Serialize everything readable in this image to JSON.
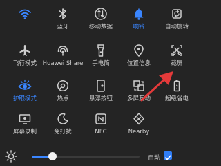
{
  "colors": {
    "background": "#242424",
    "text": "#cfcfcf",
    "active": "#3a86ff",
    "arrow": "#e43a3a"
  },
  "tiles": [
    {
      "label": "",
      "icon": "wifi-icon",
      "active": true
    },
    {
      "label": "蓝牙",
      "icon": "bluetooth-icon",
      "active": false
    },
    {
      "label": "移动数据",
      "icon": "mobile-data-icon",
      "active": false
    },
    {
      "label": "响铃",
      "icon": "bell-icon",
      "active": true
    },
    {
      "label": "自动旋转",
      "icon": "rotate-icon",
      "active": false
    },
    {
      "label": "飞行模式",
      "icon": "airplane-icon",
      "active": false
    },
    {
      "label": "Huawei Share",
      "icon": "huawei-share-icon",
      "active": false
    },
    {
      "label": "手电筒",
      "icon": "flashlight-icon",
      "active": false
    },
    {
      "label": "位置信息",
      "icon": "location-icon",
      "active": false
    },
    {
      "label": "截屏",
      "icon": "screenshot-icon",
      "active": false
    },
    {
      "label": "护眼模式",
      "icon": "eye-comfort-icon",
      "active": true
    },
    {
      "label": "热点",
      "icon": "hotspot-icon",
      "active": false
    },
    {
      "label": "悬浮按钮",
      "icon": "floating-button-icon",
      "active": false
    },
    {
      "label": "多屏互动",
      "icon": "multi-screen-icon",
      "active": false
    },
    {
      "label": "超级省电",
      "icon": "battery-saver-icon",
      "active": false
    },
    {
      "label": "屏幕录制",
      "icon": "screen-record-icon",
      "active": false
    },
    {
      "label": "免打扰",
      "icon": "moon-icon",
      "active": false
    },
    {
      "label": "NFC",
      "icon": "nfc-icon",
      "active": false
    },
    {
      "label": "Nearby",
      "icon": "nearby-icon",
      "active": false
    }
  ],
  "brightness": {
    "icon": "sun-icon",
    "level": 0.19,
    "auto_label": "自动",
    "auto_checked": true
  }
}
